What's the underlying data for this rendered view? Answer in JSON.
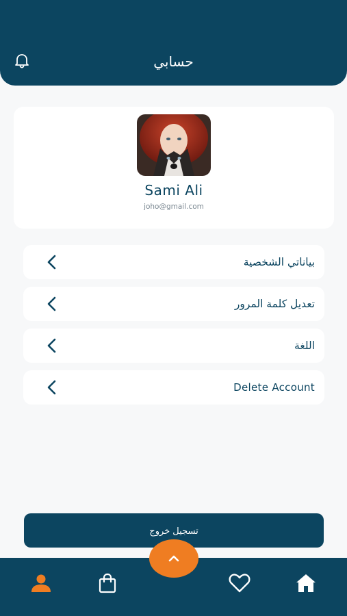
{
  "header": {
    "title": "حسابي",
    "bell_icon": "bell-icon"
  },
  "profile": {
    "name": "Sami Ali",
    "email": "joho@gmail.com",
    "avatar_icon": "avatar-photo"
  },
  "menu": {
    "items": [
      {
        "label": "بياناتي الشخصية",
        "icon": "chevron-left-icon"
      },
      {
        "label": "تعديل كلمة المرور",
        "icon": "chevron-left-icon"
      },
      {
        "label": "اللغة",
        "icon": "chevron-left-icon"
      },
      {
        "label": "Delete Account",
        "icon": "chevron-left-icon"
      }
    ]
  },
  "logout": {
    "label": "تسجيل خروج"
  },
  "bottom_nav": {
    "items": [
      "user-icon",
      "shopping-bag-icon",
      "heart-icon",
      "home-icon"
    ],
    "active": "user-icon",
    "fab_icon": "chevron-up-icon"
  },
  "colors": {
    "primary": "#0c4560",
    "accent": "#ef7d22",
    "background": "#f7f8f9"
  }
}
